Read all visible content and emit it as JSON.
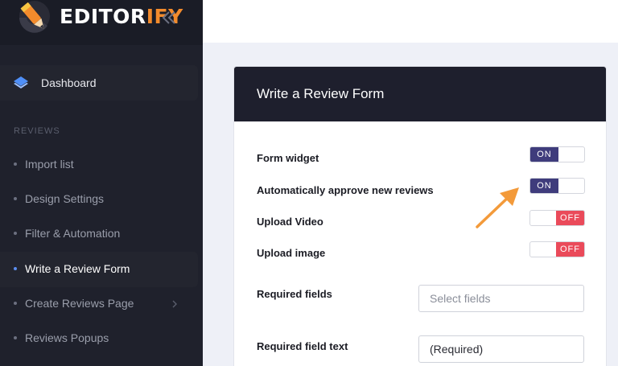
{
  "brand": {
    "name_prefix": "EDITOR",
    "name_accent": "IFY",
    "accent_color": "#f38b2c"
  },
  "sidebar": {
    "dashboard": {
      "label": "Dashboard",
      "icon": "layers-icon"
    },
    "section": "REVIEWS",
    "items": [
      {
        "label": "Import list"
      },
      {
        "label": "Design Settings"
      },
      {
        "label": "Filter & Automation"
      },
      {
        "label": "Write a Review Form",
        "active": true
      },
      {
        "label": "Create Reviews Page",
        "has_chevron": true
      },
      {
        "label": "Reviews Popups"
      }
    ]
  },
  "form": {
    "title": "Write a Review Form",
    "rows": [
      {
        "label": "Form widget",
        "toggle": "ON"
      },
      {
        "label": "Automatically approve new reviews",
        "toggle": "ON"
      },
      {
        "label": "Upload Video",
        "toggle": "OFF"
      },
      {
        "label": "Upload image",
        "toggle": "OFF"
      }
    ],
    "required_fields": {
      "label": "Required fields",
      "placeholder": "Select fields"
    },
    "required_field_text": {
      "label": "Required field text",
      "value": "(Required)"
    }
  },
  "colors": {
    "toggle_on": "#3f3c7c",
    "toggle_off": "#ea4a5a",
    "arrow": "#f39a3a",
    "active_dot": "#5b8ef0"
  }
}
